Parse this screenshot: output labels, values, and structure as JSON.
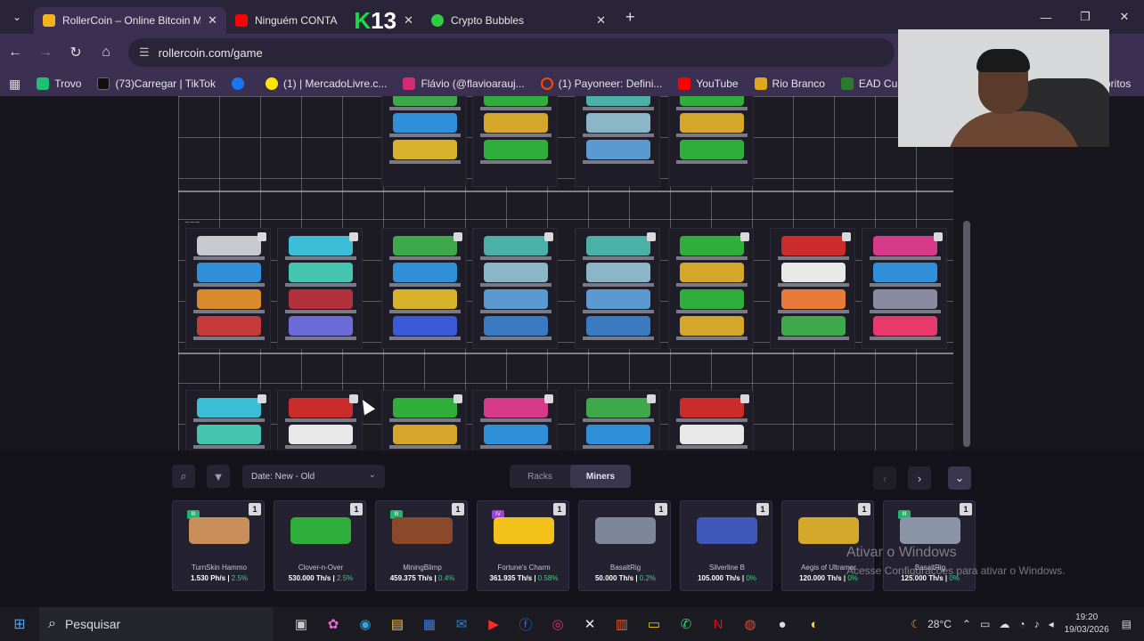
{
  "browser": {
    "tabs": [
      {
        "label": "RollerCoin – Online Bitcoin Mining",
        "color": "#f5b21a",
        "active": true
      },
      {
        "label": "Ninguém CONTA",
        "color": "#ff0000",
        "active": false
      },
      {
        "label": "Crypto Bubbles",
        "color": "#2ecc40",
        "active": false
      }
    ],
    "overlay_badge": "13",
    "url": "rollercoin.com/game",
    "bookmarks": [
      {
        "label": "Trovo",
        "color": "#1ec073"
      },
      {
        "label": "(73)Carregar | TikTok",
        "color": "#111111"
      },
      {
        "label": "",
        "color": "#1877f2"
      },
      {
        "label": "(1) | MercadoLivre.c...",
        "color": "#ffe600"
      },
      {
        "label": "Flávio (@flavioarauj...",
        "color": "#d62976"
      },
      {
        "label": "(1) Payoneer: Defini...",
        "color": "#ff4800"
      },
      {
        "label": "YouTube",
        "color": "#ff0000"
      },
      {
        "label": "Rio Branco",
        "color": "#e0a81c"
      },
      {
        "label": "EAD Cursos de Trân",
        "color": "#2c7a2c"
      }
    ],
    "bookmarks_overflow": "oritos"
  },
  "game": {
    "plan_label": "~~~",
    "cursor": "pointer"
  },
  "inventory": {
    "sort_label": "Date: New - Old",
    "tabs": [
      "Racks",
      "Miners"
    ],
    "active_tab": "Miners",
    "items": [
      {
        "name": "TurnSkin Hammo",
        "power": "1.530 Ph/s",
        "bonus": "2.5%",
        "qty": "1",
        "level": "III",
        "level_color": "#27b06e",
        "art_color": "#c98f5a"
      },
      {
        "name": "Clover-n-Over",
        "power": "530.000 Th/s",
        "bonus": "2.5%",
        "qty": "1",
        "level": "",
        "level_color": "#27b06e",
        "art_color": "#2fae3b"
      },
      {
        "name": "MiningBlimp",
        "power": "459.375 Th/s",
        "bonus": "0.4%",
        "qty": "1",
        "level": "III",
        "level_color": "#27b06e",
        "art_color": "#8a4a2a"
      },
      {
        "name": "Fortune's Charm",
        "power": "361.935 Th/s",
        "bonus": "0.58%",
        "qty": "1",
        "level": "IV",
        "level_color": "#9b3fd6",
        "art_color": "#f2c11a"
      },
      {
        "name": "BasaltRig",
        "power": "50.000 Th/s",
        "bonus": "0.2%",
        "qty": "1",
        "level": "",
        "level_color": "#27b06e",
        "art_color": "#7d8799"
      },
      {
        "name": "Silverline B",
        "power": "105.000 Th/s",
        "bonus": "0%",
        "qty": "1",
        "level": "",
        "level_color": "#27b06e",
        "art_color": "#4058b8"
      },
      {
        "name": "Aegis of Ultramar",
        "power": "120.000 Th/s",
        "bonus": "0%",
        "qty": "1",
        "level": "",
        "level_color": "#27b06e",
        "art_color": "#d4a82a"
      },
      {
        "name": "BasaltRig",
        "power": "125.000 Th/s",
        "bonus": "0%",
        "qty": "1",
        "level": "III",
        "level_color": "#27b06e",
        "art_color": "#8a95a8"
      }
    ]
  },
  "windows_activation": {
    "title": "Ativar o Windows",
    "subtitle": "Acesse Configurações para ativar o Windows."
  },
  "taskbar": {
    "search_placeholder": "Pesquisar",
    "weather": "28°C",
    "time": "19:20",
    "date": "19/03/2026"
  }
}
